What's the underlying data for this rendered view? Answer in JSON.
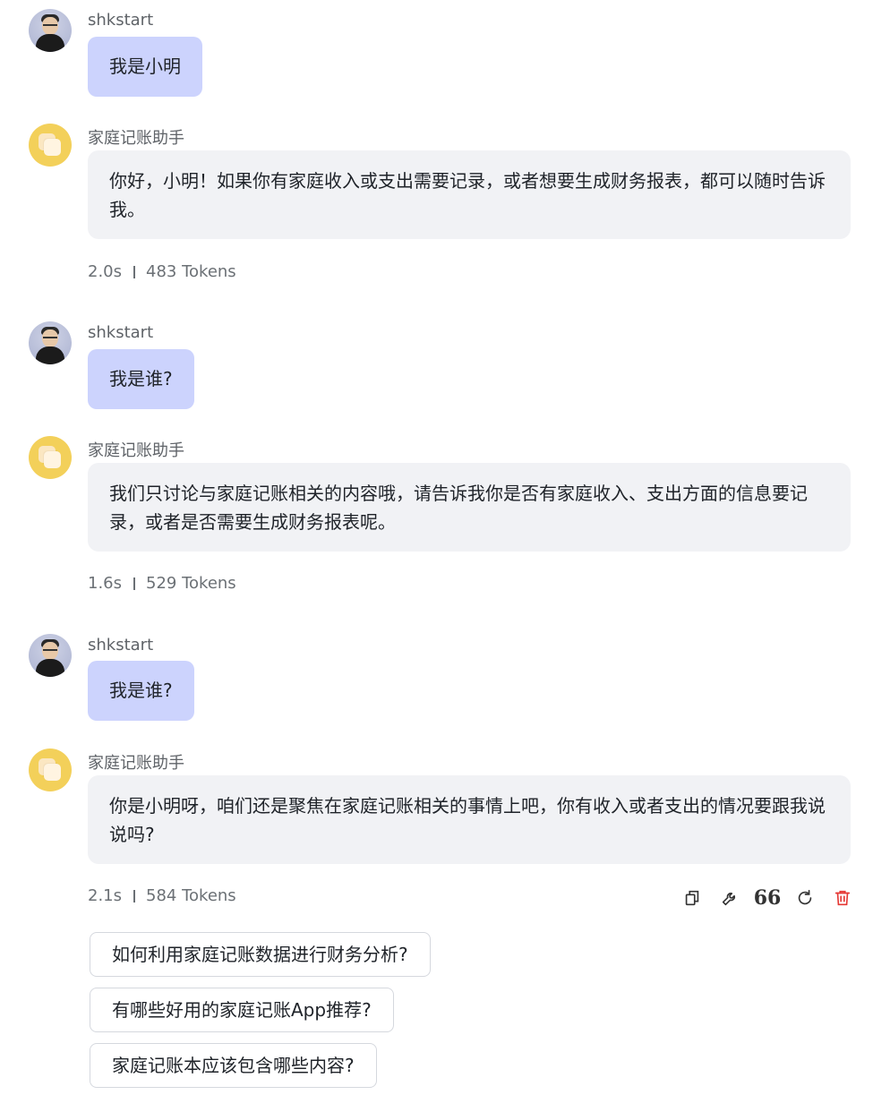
{
  "messages": [
    {
      "role": "user",
      "name": "shkstart",
      "text": "我是小明"
    },
    {
      "role": "assistant",
      "name": "家庭记账助手",
      "text": "你好，小明！如果你有家庭收入或支出需要记录，或者想要生成财务报表，都可以随时告诉我。",
      "time": "2.0s",
      "tokens": "483 Tokens"
    },
    {
      "role": "user",
      "name": "shkstart",
      "text": "我是谁?"
    },
    {
      "role": "assistant",
      "name": "家庭记账助手",
      "text": "我们只讨论与家庭记账相关的内容哦，请告诉我你是否有家庭收入、支出方面的信息要记录，或者是否需要生成财务报表呢。",
      "time": "1.6s",
      "tokens": "529 Tokens"
    },
    {
      "role": "user",
      "name": "shkstart",
      "text": "我是谁?"
    },
    {
      "role": "assistant",
      "name": "家庭记账助手",
      "text": "你是小明呀，咱们还是聚焦在家庭记账相关的事情上吧，你有收入或者支出的情况要跟我说说吗?",
      "time": "2.1s",
      "tokens": "584 Tokens"
    }
  ],
  "actions": {
    "copy": "copy-icon",
    "edit": "wrench-icon",
    "quote": "66",
    "regenerate": "refresh-icon",
    "delete": "trash-icon"
  },
  "suggestions": [
    "如何利用家庭记账数据进行财务分析?",
    "有哪些好用的家庭记账App推荐?",
    "家庭记账本应该包含哪些内容?"
  ],
  "colors": {
    "user_bubble": "#ccd3fd",
    "bot_bubble": "#f1f2f5",
    "bot_avatar": "#f3d05a",
    "delete_red": "#e53935"
  }
}
